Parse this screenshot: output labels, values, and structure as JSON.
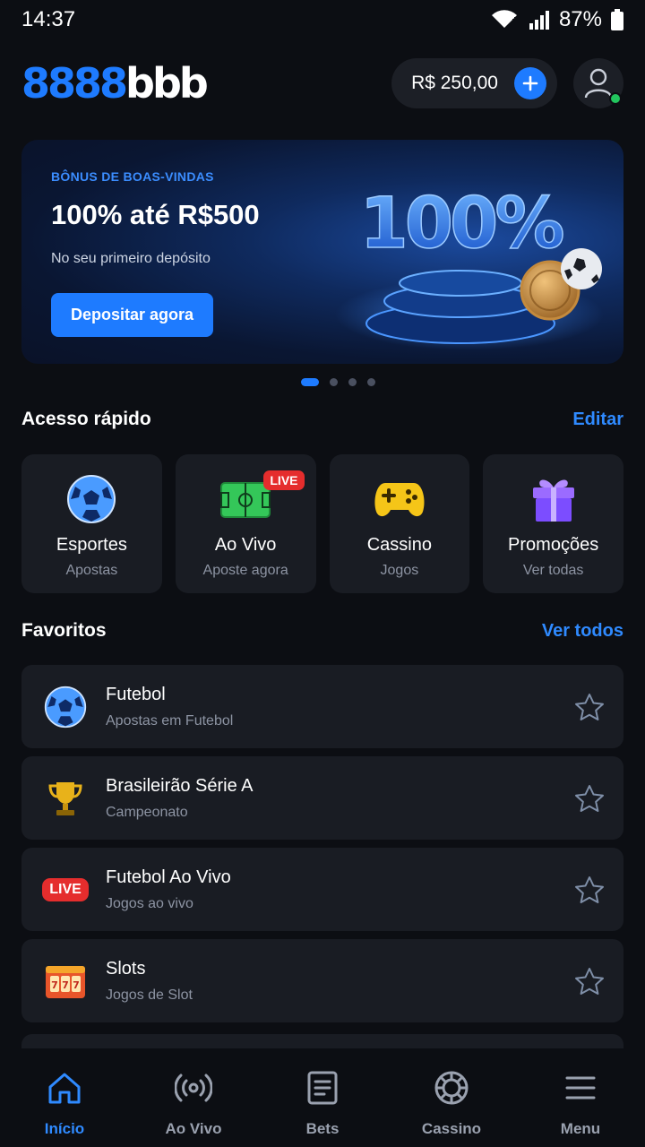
{
  "status_bar": {
    "time": "14:37",
    "battery": "87%"
  },
  "header": {
    "logo_part1": "8888",
    "logo_part2": "bbb",
    "balance": "R$ 250,00"
  },
  "banner": {
    "eyebrow": "BÔNUS DE BOAS-VINDAS",
    "title": "100% até R$500",
    "subtitle": "No seu primeiro depósito",
    "cta": "Depositar agora",
    "art_text": "100%"
  },
  "quick_access": {
    "title": "Acesso rápido",
    "edit": "Editar",
    "items": [
      {
        "label": "Esportes",
        "sub": "Apostas",
        "icon": "soccer-ball-icon"
      },
      {
        "label": "Ao Vivo",
        "sub": "Aposte agora",
        "icon": "soccer-field-icon",
        "badge": "LIVE"
      },
      {
        "label": "Cassino",
        "sub": "Jogos",
        "icon": "gamepad-icon"
      },
      {
        "label": "Promoções",
        "sub": "Ver todas",
        "icon": "gift-icon"
      }
    ]
  },
  "favorites": {
    "title": "Favoritos",
    "see_all": "Ver todos",
    "items": [
      {
        "title": "Futebol",
        "sub": "Apostas em Futebol",
        "icon": "soccer-ball-icon"
      },
      {
        "title": "Brasileirão Série A",
        "sub": "Campeonato",
        "icon": "trophy-icon"
      },
      {
        "title": "Futebol Ao Vivo",
        "sub": "Jogos ao vivo",
        "icon": "live-badge-icon",
        "badge": "LIVE"
      },
      {
        "title": "Slots",
        "sub": "Jogos de Slot",
        "icon": "slot-machine-icon"
      }
    ]
  },
  "bottom_nav": [
    {
      "label": "Início",
      "icon": "home-icon",
      "active": true
    },
    {
      "label": "Ao Vivo",
      "icon": "broadcast-icon"
    },
    {
      "label": "Bets",
      "icon": "betslip-icon"
    },
    {
      "label": "Cassino",
      "icon": "casino-chip-icon"
    },
    {
      "label": "Menu",
      "icon": "menu-icon"
    }
  ],
  "colors": {
    "accent": "#1e7bff",
    "background": "#0c0e13",
    "card": "#191c23",
    "live": "#e52d2d",
    "online": "#22c55e"
  }
}
